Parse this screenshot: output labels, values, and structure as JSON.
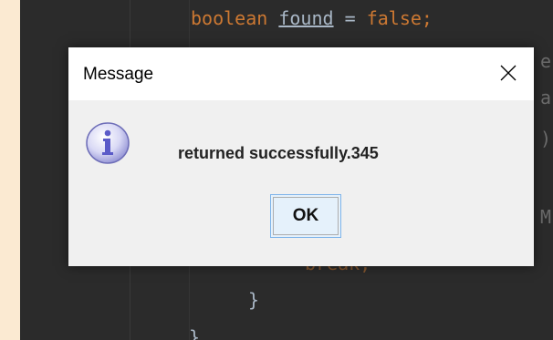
{
  "editor": {
    "code_keyword": "boolean",
    "code_variable": "found",
    "code_equals": "=",
    "code_value": "false;",
    "fragment_right_1": "e",
    "fragment_right_2": "a",
    "fragment_right_3": ")",
    "fragment_right_4": "M",
    "fragment_below_dialog": "break;",
    "closing_brace_1": "}",
    "closing_brace_2": "}"
  },
  "dialog": {
    "title": "Message",
    "message": "returned successfully.345",
    "ok_label": "OK",
    "icon": "info-icon",
    "close_icon": "close-icon"
  },
  "colors": {
    "page_background": "#fbead2",
    "editor_background": "#2b2b2b",
    "keyword": "#cc7832",
    "dialog_background": "#f0f0f0",
    "button_background": "#e5f1fb",
    "button_border": "#7eb4ea"
  }
}
